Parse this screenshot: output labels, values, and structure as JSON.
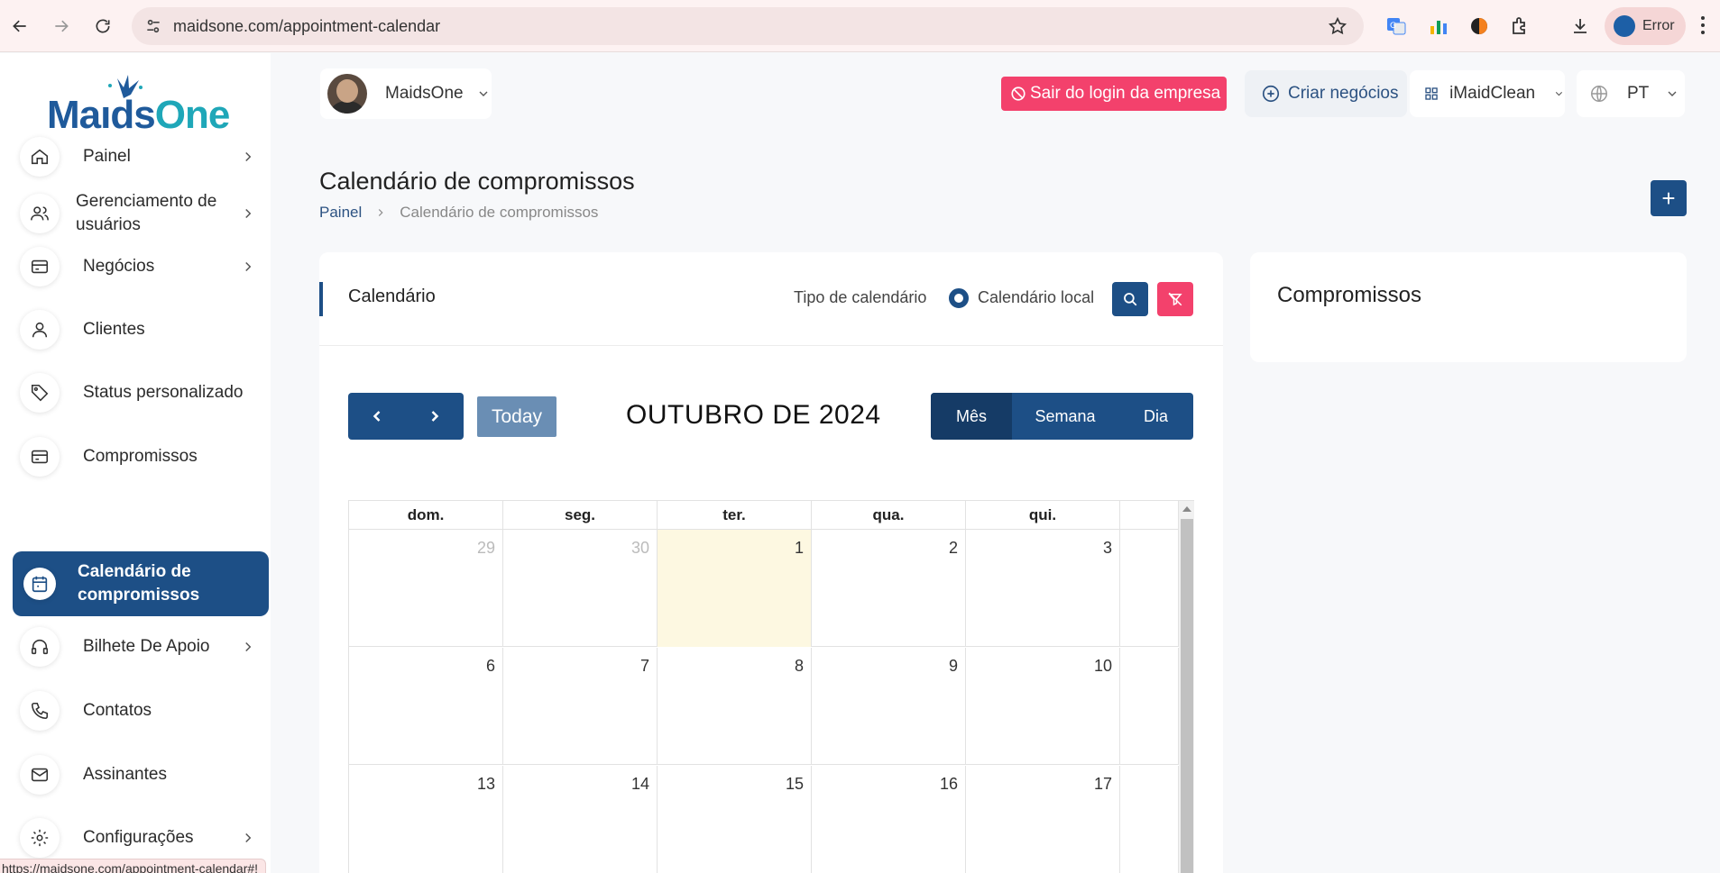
{
  "browser": {
    "url": "maidsone.com/appointment-calendar",
    "profile_label": "Error",
    "status_url": "https://maidsone.com/appointment-calendar#!"
  },
  "logo": {
    "part1": "Ma",
    "part2": "ds",
    "part3": "One"
  },
  "sidebar": {
    "items": [
      {
        "label": "Painel",
        "icon": "home-icon",
        "has_chevron": true
      },
      {
        "label": "Gerenciamento de usuários",
        "icon": "users-icon",
        "has_chevron": true
      },
      {
        "label": "Negócios",
        "icon": "card-icon",
        "has_chevron": true
      },
      {
        "label": "Clientes",
        "icon": "user-icon",
        "has_chevron": false
      },
      {
        "label": "Status personalizado",
        "icon": "tag-icon",
        "has_chevron": false
      },
      {
        "label": "Compromissos",
        "icon": "card-icon",
        "has_chevron": false
      },
      {
        "label": "Calendário de compromissos",
        "icon": "calendar-icon",
        "has_chevron": false,
        "active": true
      },
      {
        "label": "Bilhete De Apoio",
        "icon": "headset-icon",
        "has_chevron": true
      },
      {
        "label": "Contatos",
        "icon": "phone-icon",
        "has_chevron": false
      },
      {
        "label": "Assinantes",
        "icon": "mail-icon",
        "has_chevron": false
      },
      {
        "label": "Configurações",
        "icon": "gear-icon",
        "has_chevron": true
      }
    ]
  },
  "header": {
    "company_name": "MaidsOne",
    "logout_label": "Sair do login da empresa",
    "create_business_label": "Criar negócios",
    "app_label": "iMaidClean",
    "language": "PT"
  },
  "page": {
    "title": "Calendário de compromissos",
    "breadcrumb_root": "Painel",
    "breadcrumb_current": "Calendário de compromissos",
    "add_label": "+"
  },
  "calendar_card": {
    "title": "Calendário",
    "type_label": "Tipo de calendário",
    "type_value": "Calendário local",
    "today_label": "Today",
    "month_title": "OUTUBRO DE 2024",
    "views": {
      "month": "Mês",
      "week": "Semana",
      "day": "Dia"
    },
    "weekdays": [
      "dom.",
      "seg.",
      "ter.",
      "qua.",
      "qui."
    ],
    "weeks": [
      [
        "29",
        "30",
        "1",
        "2",
        "3"
      ],
      [
        "6",
        "7",
        "8",
        "9",
        "10"
      ],
      [
        "13",
        "14",
        "15",
        "16",
        "17"
      ]
    ],
    "today_date": "1",
    "accent_color": "#1d4f86",
    "today_bg": "#fdf8e1"
  },
  "appointments_card": {
    "title": "Compromissos"
  },
  "colors": {
    "primary": "#1d4f86",
    "danger": "#f3416c"
  }
}
